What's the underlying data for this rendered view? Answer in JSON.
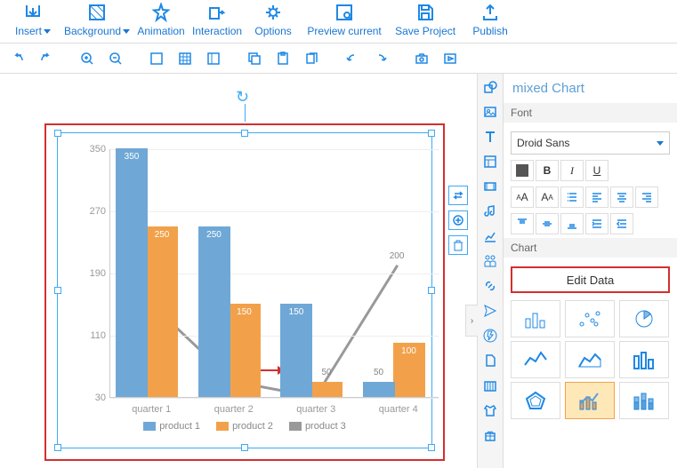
{
  "ribbon": {
    "insert": "Insert",
    "background": "Background",
    "animation": "Animation",
    "interaction": "Interaction",
    "options": "Options",
    "preview": "Preview current",
    "save": "Save Project",
    "publish": "Publish"
  },
  "panel": {
    "title": "mixed Chart",
    "font_label": "Font",
    "font_value": "Droid Sans",
    "chart_label": "Chart",
    "edit_data": "Edit Data",
    "bold": "B",
    "italic": "I",
    "underline": "U"
  },
  "chart_data": {
    "type": "bar",
    "categories": [
      "quarter 1",
      "quarter 2",
      "quarter 3",
      "quarter 4"
    ],
    "series": [
      {
        "name": "product 1",
        "values": [
          350,
          250,
          150,
          50
        ],
        "color": "#6fa8d6",
        "kind": "bar"
      },
      {
        "name": "product 2",
        "values": [
          250,
          150,
          50,
          100
        ],
        "color": "#f2a14a",
        "kind": "bar"
      },
      {
        "name": "product 3",
        "values": [
          150,
          50,
          30,
          200
        ],
        "color": "#999999",
        "kind": "line"
      }
    ],
    "y_ticks": [
      30,
      110,
      190,
      270,
      350
    ],
    "ylim": [
      30,
      350
    ],
    "legend": [
      "product 1",
      "product 2",
      "product 3"
    ],
    "legend_colors": [
      "#6fa8d6",
      "#f2a14a",
      "#999999"
    ]
  }
}
